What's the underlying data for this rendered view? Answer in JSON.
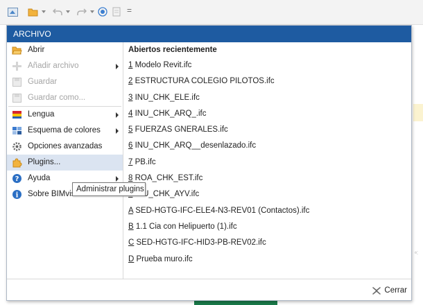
{
  "qat": {
    "separator": "="
  },
  "menu": {
    "header": "ARCHIVO",
    "items": [
      {
        "label": "Abrir",
        "icon": "folder-open-icon",
        "disabled": false,
        "submenu": false
      },
      {
        "label": "Añadir archivo",
        "icon": "add-file-icon",
        "disabled": true,
        "submenu": true
      },
      {
        "label": "Guardar",
        "icon": "save-icon",
        "disabled": true,
        "submenu": false
      },
      {
        "label": "Guardar como...",
        "icon": "save-as-icon",
        "disabled": true,
        "submenu": false
      },
      {
        "label": "Lengua",
        "icon": "language-flag-icon",
        "disabled": false,
        "submenu": true
      },
      {
        "label": "Esquema de colores",
        "icon": "color-scheme-icon",
        "disabled": false,
        "submenu": true
      },
      {
        "label": "Opciones avanzadas",
        "icon": "gear-icon",
        "disabled": false,
        "submenu": false
      },
      {
        "label": "Plugins...",
        "icon": "puzzle-icon",
        "disabled": false,
        "submenu": false
      },
      {
        "label": "Ayuda",
        "icon": "help-icon",
        "disabled": false,
        "submenu": true
      },
      {
        "label": "Sobre BIMvision",
        "icon": "info-icon",
        "disabled": false,
        "submenu": false
      }
    ],
    "recent_title": "Abiertos recientemente",
    "recent": [
      {
        "key": "1",
        "name": " Modelo Revit.ifc"
      },
      {
        "key": "2",
        "name": " ESTRUCTURA COLEGIO PILOTOS.ifc"
      },
      {
        "key": "3",
        "name": " INU_CHK_ELE.ifc"
      },
      {
        "key": "4",
        "name": " INU_CHK_ARQ_.ifc"
      },
      {
        "key": "5",
        "name": " FUERZAS GNERALES.ifc"
      },
      {
        "key": "6",
        "name": " INU_CHK_ARQ__desenlazado.ifc"
      },
      {
        "key": "7",
        "name": " PB.ifc"
      },
      {
        "key": "8",
        "name": " ROA_CHK_EST.ifc"
      },
      {
        "key": "9",
        "name": " INU_CHK_AYV.ifc"
      },
      {
        "key": "A",
        "name": " SED-HGTG-IFC-ELE4-N3-REV01 (Contactos).ifc"
      },
      {
        "key": "B",
        "name": " 1.1 Cia con Helipuerto (1).ifc"
      },
      {
        "key": "C",
        "name": " SED-HGTG-IFC-HID3-PB-REV02.ifc"
      },
      {
        "key": "D",
        "name": " Prueba muro.ifc"
      }
    ],
    "close_label": "Cerrar"
  },
  "tooltip": "Administrar plugins",
  "colors": {
    "header_bg": "#1e5ba1",
    "hover_bg": "#dbe4f1",
    "disabled_text": "#a5a5a5"
  }
}
